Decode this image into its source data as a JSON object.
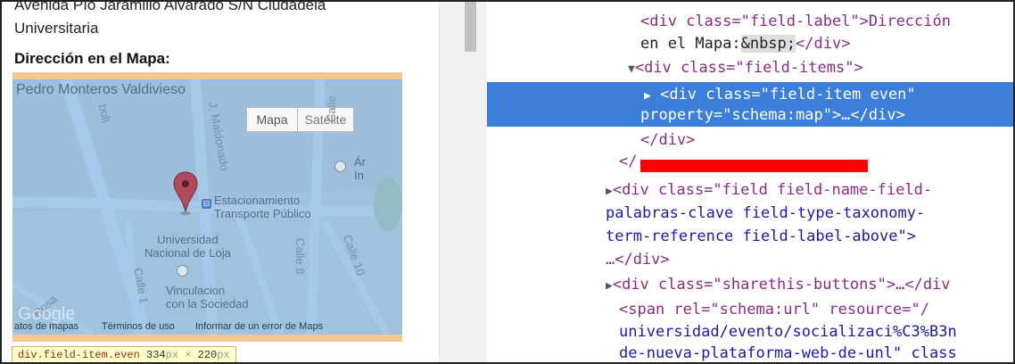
{
  "page": {
    "address_line1": "Avenida Pío Jaramillo Alvarado S/N Ciudadela",
    "address_line2": "Universitaria",
    "map_field_label": "Dirección en el Mapa:",
    "map": {
      "place_title": "Pedro Monteros Valdivieso",
      "map_button": "Mapa",
      "satellite_button": "Satélite",
      "poi_parking_line1": "Estacionamiento",
      "poi_parking_line2": "Transporte Público",
      "poi_university_line1": "Universidad",
      "poi_university_line2": "Nacional de Loja",
      "poi_vinculacion_line1": "Vinculacion",
      "poi_vinculacion_line2": "con la Sociedad",
      "street_bolt": "bolt",
      "street_maldonado": "J. Maldonado",
      "street_calle_top": "Calle",
      "street_calle8": "Calle 8",
      "street_calle10": "Calle 10",
      "street_calle_left": "Calle 1",
      "street_rosa": "Rosa",
      "poi_right_line1": "Ár",
      "poi_right_line2": "In",
      "attribution_data": "atos de mapas",
      "attribution_terms": "Términos de uso",
      "attribution_report": "Informar de un error de Maps",
      "watermark": "Google"
    },
    "inspect_tooltip": {
      "selector": "div.field-item.even",
      "width": "334",
      "height": "220",
      "unit": "px",
      "times": "×"
    }
  },
  "devtools": {
    "lines": {
      "l1a": "<div class=\"field-label\">Dirección",
      "l1b_text": "en el Mapa:",
      "l1b_entity": "&nbsp;",
      "l1b_close": "</div>",
      "l2": "<div class=\"field-items\">",
      "l3a": "<div class=\"field-item even\"",
      "l3b": "property=\"schema:map\">…</div>",
      "l4": "</div>",
      "l5": "</",
      "l6a": "<div class=\"field field-name-field-",
      "l6b": "palabras-clave field-type-taxonomy-",
      "l6c": "term-reference field-label-above\">",
      "l6d": "…</div>",
      "l7": "<div class=\"sharethis-buttons\">…</div",
      "l8a": "<span rel=\"schema:url\" resource=\"/",
      "l8b": "universidad/evento/socializaci%C3%B3n",
      "l8c": "de-nueva-plataforma-web-de-unl\" class"
    }
  },
  "colors": {
    "selection": "#3b7fdb",
    "map_overlay": "#6fa8dc",
    "padding_highlight": "#f6c891",
    "redaction": "#ff0000"
  }
}
